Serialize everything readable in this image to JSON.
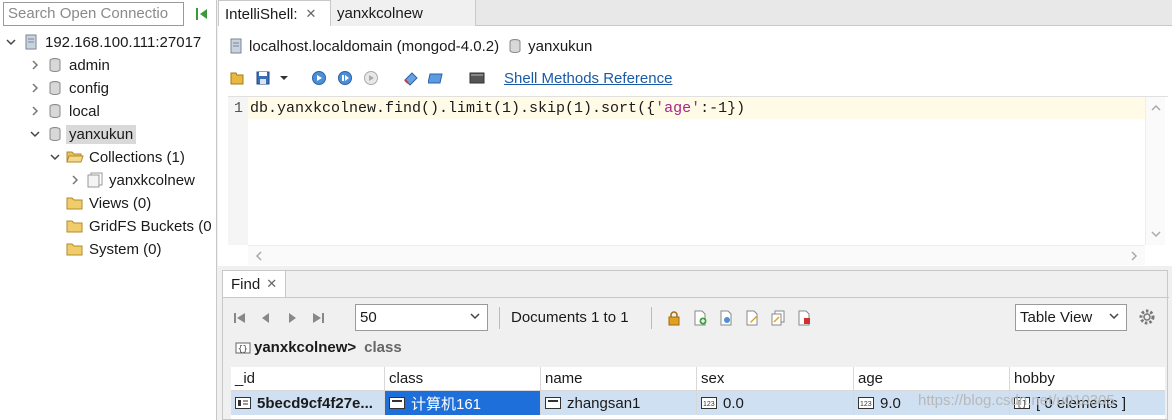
{
  "left_panel": {
    "search_placeholder": "Search Open Connectio",
    "tree": {
      "connection": "192.168.100.111:27017",
      "databases": [
        "admin",
        "config",
        "local",
        "yanxukun"
      ],
      "collections": "Collections (1)",
      "collection_item": "yanxkcolnew",
      "views": "Views (0)",
      "gridfs": "GridFS Buckets (0",
      "system": "System (0)"
    }
  },
  "tabs": [
    {
      "label": "IntelliShell:",
      "closable": true
    },
    {
      "label": "yanxkcolnew",
      "closable": false
    }
  ],
  "shell": {
    "connection": "localhost.localdomain (mongod-4.0.2)",
    "database": "yanxukun",
    "shell_methods_link": "Shell Methods Reference",
    "line_number": "1",
    "code_prefix": "db.yanxkcolnew.find().limit(1).skip(1).sort({",
    "code_key": "'age'",
    "code_suffix": ":-1})"
  },
  "find": {
    "tab_label": "Find",
    "page_size": "50",
    "doc_count": "Documents 1 to 1",
    "view_mode": "Table View",
    "breadcrumb_collection": "yanxkcolnew>",
    "breadcrumb_field": "class",
    "columns": [
      "_id",
      "class",
      "name",
      "sex",
      "age",
      "hobby"
    ],
    "row": [
      "5becd9cf4f27e...",
      "计算机161",
      "zhangsan1",
      "0.0",
      "9.0",
      "[ 0 elements ]"
    ]
  },
  "watermark": "https://blog.csdn.net/u010305",
  "colors": {
    "selected_row": "#cfe0f2",
    "selected_cell": "#1e6fd9",
    "link": "#1a5aa8",
    "string": "#a8238a"
  }
}
